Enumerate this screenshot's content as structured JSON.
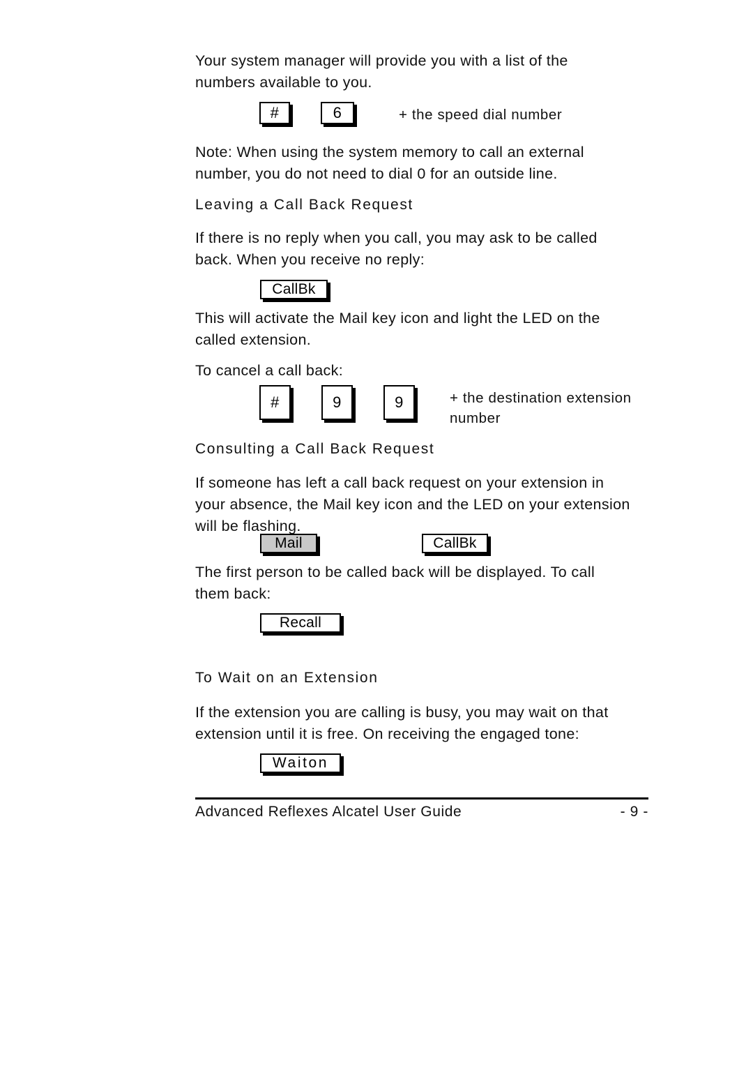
{
  "document": {
    "page_number_label": "- 9 -",
    "footer_title": "Advanced Reflexes Alcatel User Guide"
  },
  "body": {
    "intro_paragraph": "Your system manager will provide you with a list of the\nnumbers available to you.",
    "speed_dial_hint": "+ the speed dial number",
    "note_paragraph": "Note:  When using the system memory to call an external\nnumber, you do not need to dial 0 for an outside line.",
    "leaving_heading": "Leaving a Call Back Request",
    "leaving_paragraph": "If there is no reply when you call, you may ask to be called\nback.  When you receive no reply:",
    "leaving_result_paragraph": "This will activate the Mail key icon and light the LED on the\ncalled extension.",
    "cancel_lead_in": "To cancel a call back:",
    "cancel_hint": "+ the destination extension\nnumber",
    "consulting_heading": "Consulting a Call Back Request",
    "consulting_paragraph": "If someone has left a call back request on your extension in\nyour absence, the Mail key icon and the LED on your extension\nwill be flashing.",
    "consulting_result_paragraph": "The first person to be called back will be displayed.  To call\nthem back:",
    "wait_heading": "To Wait on an Extension",
    "wait_paragraph": "If the extension you are calling is busy, you may wait on that\nextension until it is free.  On receiving the engaged tone:"
  },
  "keys": {
    "speed_dial": [
      {
        "label": "#"
      },
      {
        "label": "6"
      }
    ],
    "cancel_callback": [
      {
        "label": "#"
      },
      {
        "label": "9"
      },
      {
        "label": "9"
      }
    ]
  },
  "softkeys": {
    "callbk_leave": "CallBk",
    "mail": "Mail",
    "callbk_consult": "CallBk",
    "recall": "Recall",
    "waiton": "Waiton"
  },
  "colors": {
    "ink": "#000000",
    "paper": "#ffffff",
    "key_fill_active": "#c9c9c9"
  }
}
